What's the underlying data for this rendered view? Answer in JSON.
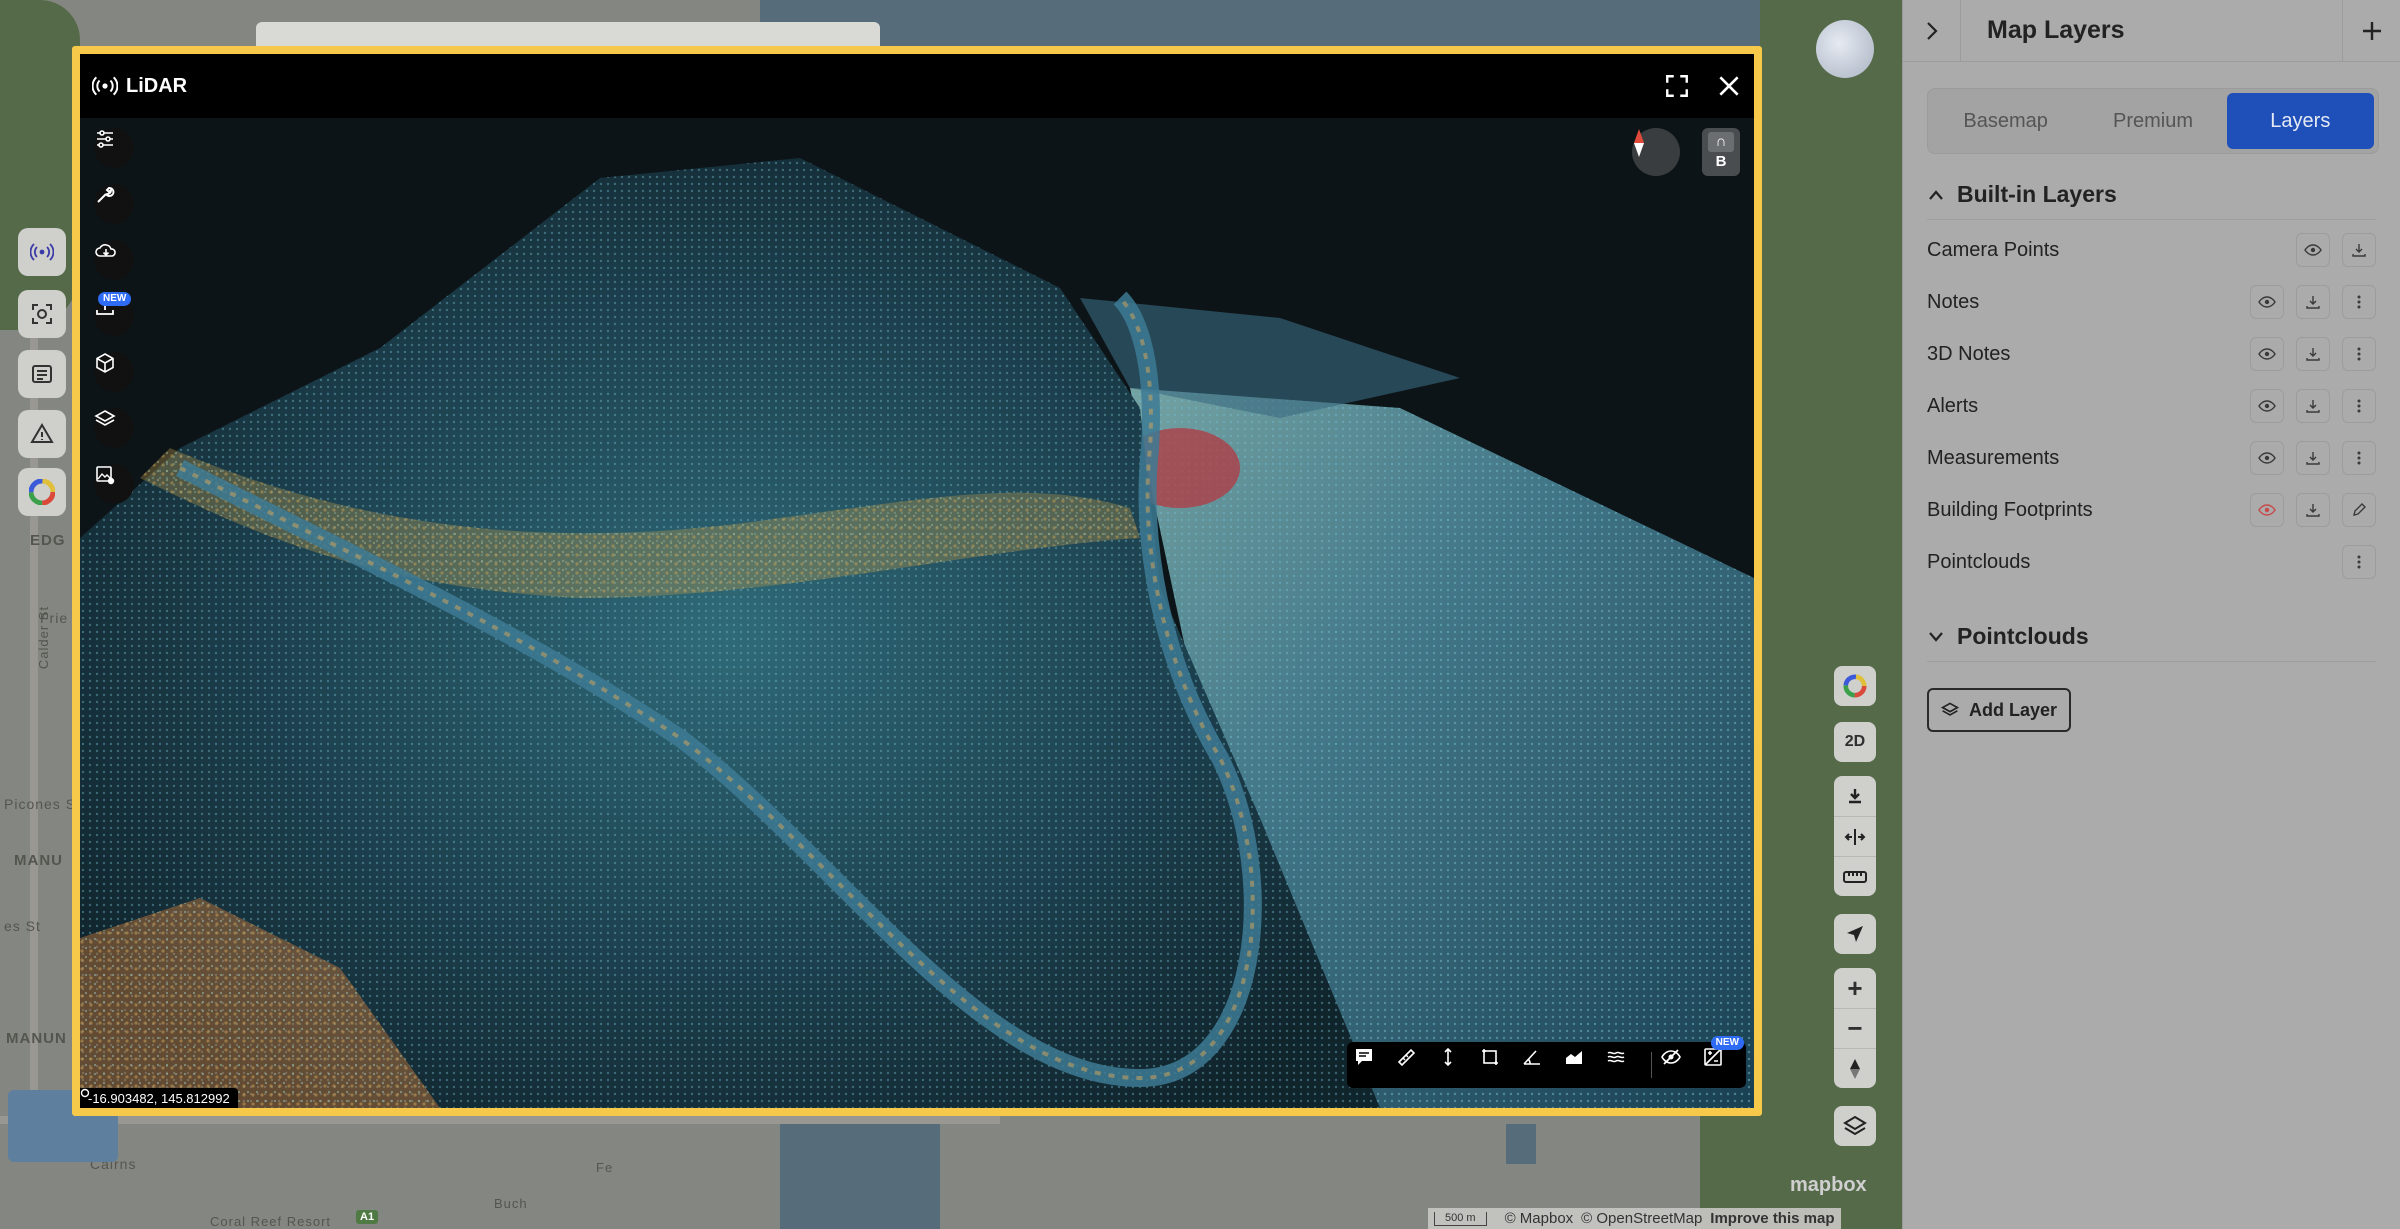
{
  "lidar_window": {
    "title": "LiDAR",
    "new_badge": "NEW",
    "tool_new_badge": "NEW",
    "coords": "-16.903482, 145.812992",
    "view_mode": {
      "top": "∩",
      "bottom": "B"
    },
    "left_tools": [
      "sliders-icon",
      "wrench-icon",
      "cloud-download-icon",
      "upload-icon",
      "cube-icon",
      "layers-icon",
      "image-settings-icon"
    ],
    "bottom_tools": [
      "note-icon",
      "ruler-icon",
      "height-icon",
      "area-icon",
      "angle-icon",
      "profile-icon",
      "contour-icon",
      "hide-icon",
      "compare-icon"
    ]
  },
  "map": {
    "labels": [
      "EDG",
      "MANU",
      "MANUN",
      "Calder St",
      "Frie",
      "Picones S",
      "es St",
      "Cairns",
      "Coral Reef Resort",
      "Buch",
      "Fe"
    ],
    "controls_2d": "2D",
    "scale": "500 m",
    "attribution": [
      "© Mapbox",
      "© OpenStreetMap",
      "Improve this map"
    ],
    "mapbox": "mapbox",
    "route_badge": "A1"
  },
  "panel": {
    "title": "Map Layers",
    "tabs": [
      "Basemap",
      "Premium",
      "Layers"
    ],
    "active_tab": "Layers",
    "built_in": {
      "title": "Built-in Layers",
      "layers": [
        {
          "name": "Camera Points",
          "actions": [
            "eye",
            "download"
          ]
        },
        {
          "name": "Notes",
          "actions": [
            "eye",
            "download",
            "more"
          ]
        },
        {
          "name": "3D Notes",
          "actions": [
            "eye",
            "download",
            "more"
          ]
        },
        {
          "name": "Alerts",
          "actions": [
            "eye",
            "download",
            "more"
          ]
        },
        {
          "name": "Measurements",
          "actions": [
            "eye",
            "download",
            "more"
          ]
        },
        {
          "name": "Building Footprints",
          "actions": [
            "eye-off",
            "download",
            "edit"
          ]
        },
        {
          "name": "Pointclouds",
          "actions": [
            "more"
          ]
        }
      ]
    },
    "pointclouds": {
      "title": "Pointclouds",
      "add_label": "Add Layer"
    }
  },
  "colors": {
    "frame": "#f7c94a",
    "accent": "#1f4fb8",
    "new_badge": "#2f6cf6"
  }
}
